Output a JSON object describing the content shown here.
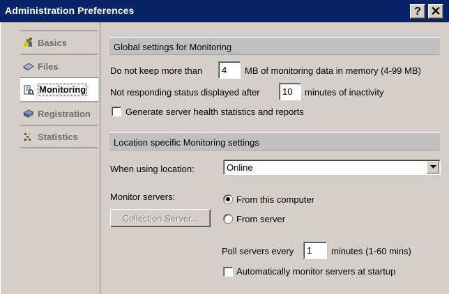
{
  "window": {
    "title": "Administration Preferences",
    "help_label": "?",
    "close_label": "✕"
  },
  "sidebar": {
    "items": [
      {
        "label": "Basics",
        "icon": "basics-icon",
        "active": false
      },
      {
        "label": "Files",
        "icon": "files-icon",
        "active": false
      },
      {
        "label": "Monitoring",
        "icon": "monitoring-icon",
        "active": true
      },
      {
        "label": "Registration",
        "icon": "registration-icon",
        "active": false
      },
      {
        "label": "Statistics",
        "icon": "statistics-icon",
        "active": false
      }
    ]
  },
  "global": {
    "header": "Global settings for Monitoring",
    "keep_label_pre": "Do not keep more than",
    "keep_value": "4",
    "keep_label_post": "MB of monitoring data in memory (4-99 MB)",
    "not_responding_pre": "Not responding status displayed after",
    "not_responding_value": "10",
    "not_responding_post": "minutes of inactivity",
    "health_checkbox_label": "Generate server health statistics and reports",
    "health_checked": false
  },
  "location": {
    "header": "Location specific Monitoring settings",
    "when_using_label": "When using location:",
    "location_value": "Online",
    "monitor_servers_label": "Monitor servers:",
    "collection_button": "Collection Server...",
    "radio_from_computer": "From this computer",
    "radio_from_server": "From server",
    "selected_radio": "From this computer",
    "poll_label_pre": "Poll servers every",
    "poll_value": "1",
    "poll_label_post": "minutes (1-60 mins)",
    "auto_monitor_label": "Automatically monitor servers at startup",
    "auto_monitor_checked": false
  },
  "colors": {
    "titlebar": "#0a246a",
    "face": "#d4d0c8",
    "group_header": "#c0c0c0"
  }
}
